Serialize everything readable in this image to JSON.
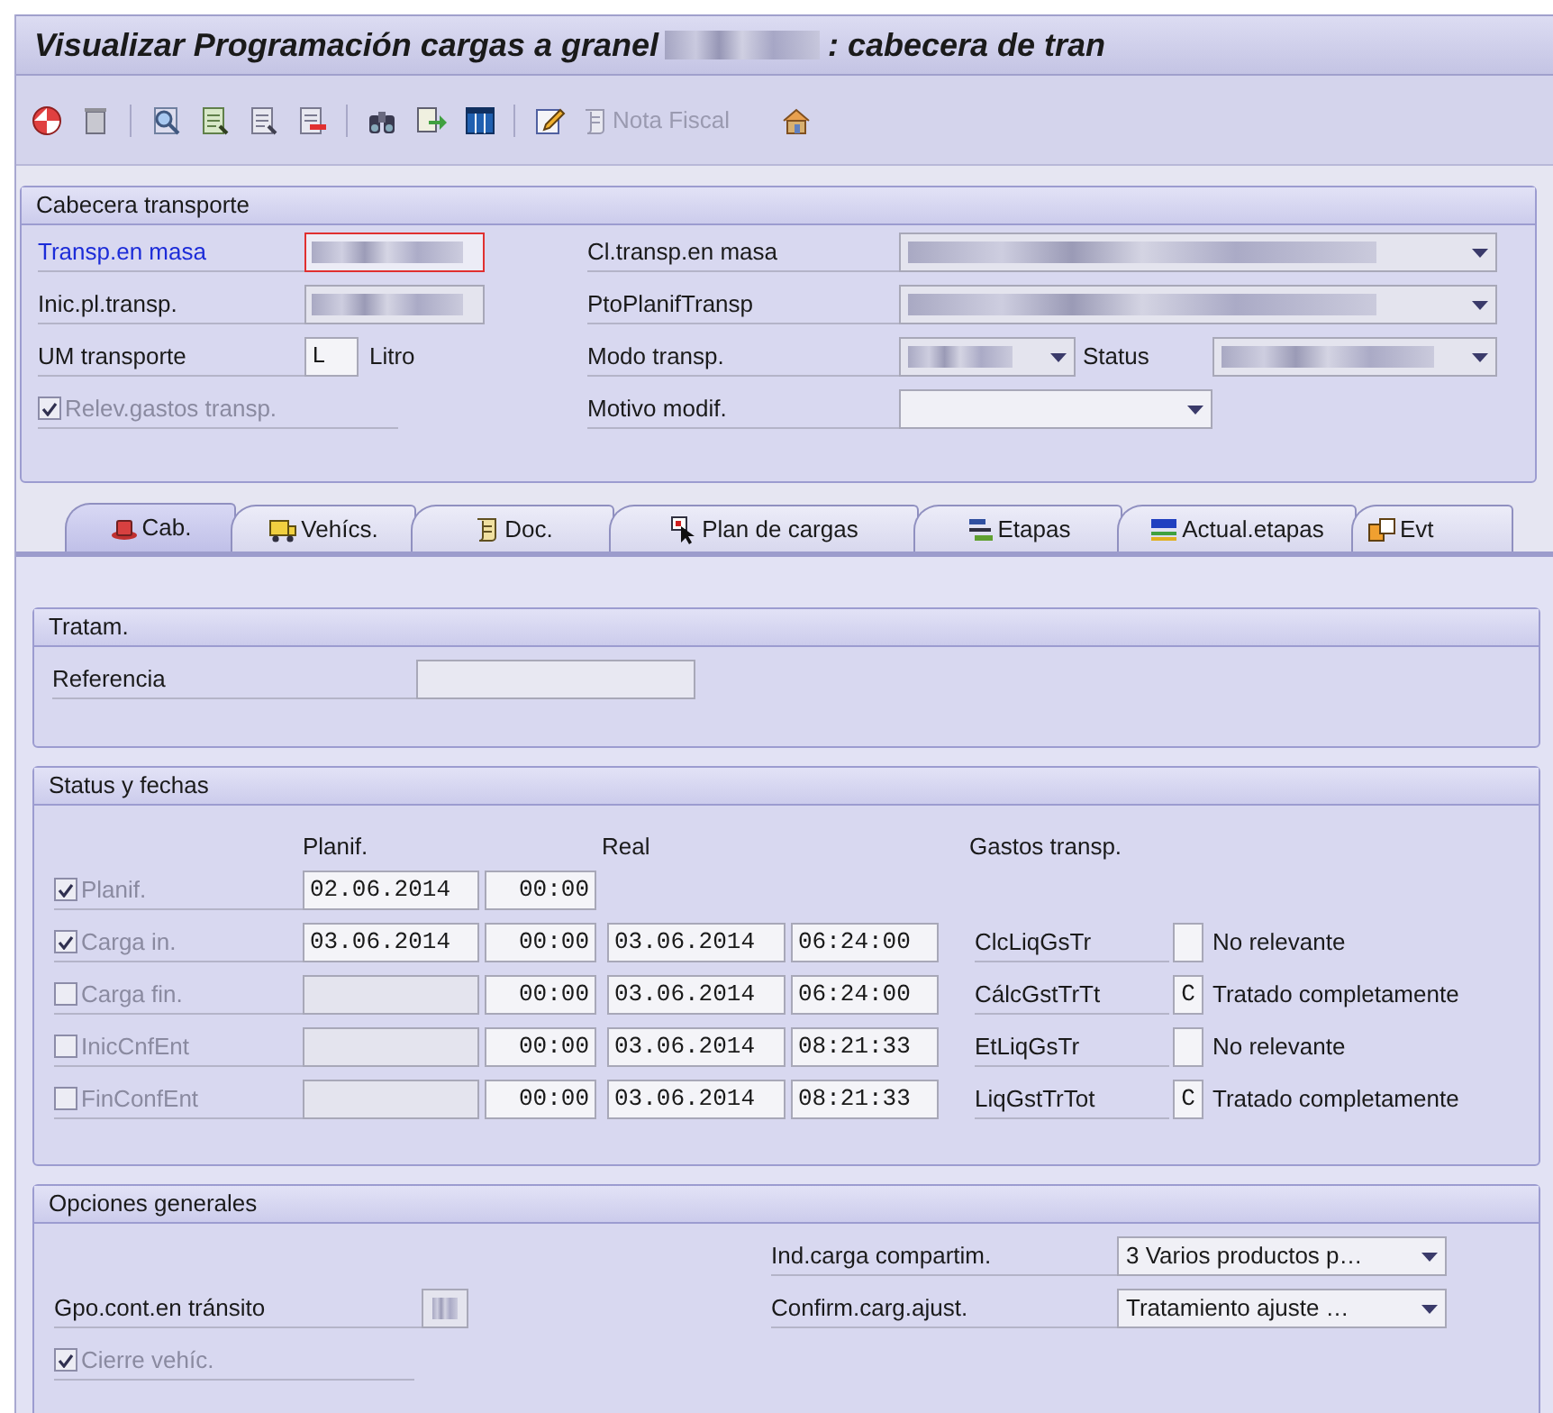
{
  "title": {
    "before": "Visualizar Programación cargas a granel",
    "redacted": true,
    "after": ": cabecera de tran"
  },
  "toolbar": {
    "nota_fiscal": {
      "label": "Nota Fiscal",
      "disabled": true
    }
  },
  "header": {
    "title": "Cabecera transporte",
    "left": [
      {
        "kind": "input",
        "label": "Transp.en masa",
        "link": true,
        "focused": true,
        "redacted": true
      },
      {
        "kind": "input",
        "label": "Inic.pl.transp.",
        "link": false,
        "focused": false,
        "redacted": true
      },
      {
        "kind": "input",
        "label": "UM transporte",
        "link": false,
        "focused": false,
        "value": "L",
        "suffix": "Litro"
      },
      {
        "kind": "checkbox",
        "label": "Relev.gastos transp.",
        "checked": true
      }
    ],
    "right": [
      {
        "kind": "dropdown",
        "label": "Cl.transp.en masa",
        "redacted": true
      },
      {
        "kind": "dropdown",
        "label": "PtoPlanifTransp",
        "redacted": true
      },
      {
        "kind": "pair",
        "label": "Modo transp.",
        "redacted": true,
        "second_label": "Status",
        "second_redacted": true
      },
      {
        "kind": "dropdown",
        "label": "Motivo modif.",
        "redacted": false
      }
    ]
  },
  "tabs": [
    {
      "label": "Cab.",
      "selected": true
    },
    {
      "label": "Vehícs.",
      "selected": false
    },
    {
      "label": "Doc.",
      "selected": false
    },
    {
      "label": "Plan de cargas",
      "selected": false
    },
    {
      "label": "Etapas",
      "selected": false
    },
    {
      "label": "Actual.etapas",
      "selected": false
    },
    {
      "label": "Evt",
      "selected": false
    }
  ],
  "tratam": {
    "title": "Tratam.",
    "field_label": "Referencia"
  },
  "status": {
    "title": "Status y fechas",
    "columns": [
      "Planif.",
      "Real",
      "Gastos transp."
    ],
    "rows": [
      {
        "label": "Planif.",
        "checked": true,
        "plan_date": "02.06.2014",
        "plan_time": "00:00"
      },
      {
        "label": "Carga in.",
        "checked": true,
        "plan_date": "03.06.2014",
        "plan_time": "00:00",
        "real_date": "03.06.2014",
        "real_time": "06:24:00",
        "cost_label": "ClcLiqGsTr",
        "cost_code": "",
        "cost_text": "No relevante"
      },
      {
        "label": "Carga fin.",
        "checked": false,
        "plan_date": "",
        "plan_time": "00:00",
        "real_date": "03.06.2014",
        "real_time": "06:24:00",
        "cost_label": "CálcGstTrTt",
        "cost_code": "C",
        "cost_text": "Tratado completamente"
      },
      {
        "label": "InicCnfEnt",
        "checked": false,
        "plan_date": "",
        "plan_time": "00:00",
        "real_date": "03.06.2014",
        "real_time": "08:21:33",
        "cost_label": "EtLiqGsTr",
        "cost_code": "",
        "cost_text": "No relevante"
      },
      {
        "label": "FinConfEnt",
        "checked": false,
        "plan_date": "",
        "plan_time": "00:00",
        "real_date": "03.06.2014",
        "real_time": "08:21:33",
        "cost_label": "LiqGstTrTot",
        "cost_code": "C",
        "cost_text": "Tratado completamente"
      }
    ]
  },
  "options": {
    "title": "Opciones generales",
    "dropdowns": [
      {
        "label": "Ind.carga compartim.",
        "value": "3 Varios productos p…"
      },
      {
        "label": "Confirm.carg.ajust.",
        "value": "Tratamiento ajuste …"
      }
    ],
    "field": {
      "label": "Gpo.cont.en tránsito",
      "redacted": true
    },
    "checkbox": {
      "label": "Cierre vehíc.",
      "checked": true
    }
  }
}
